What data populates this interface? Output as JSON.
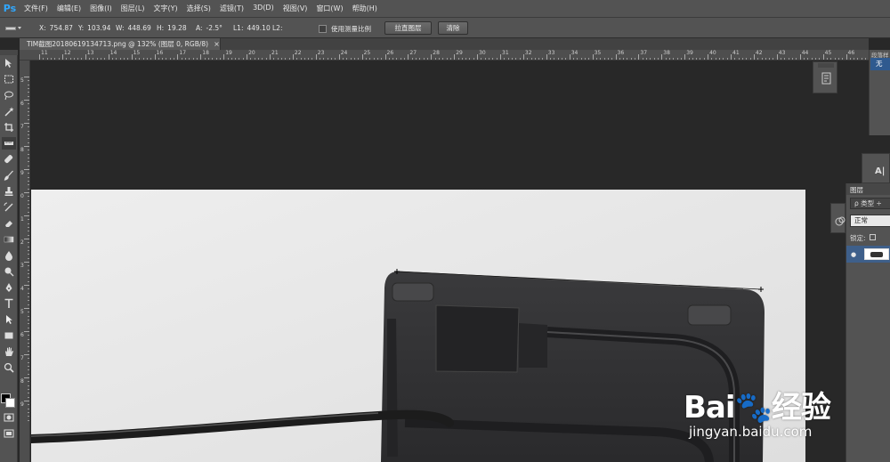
{
  "app": {
    "logo": "Ps",
    "accent": "#31a8ff"
  },
  "menu": [
    "文件(F)",
    "编辑(E)",
    "图像(I)",
    "图层(L)",
    "文字(Y)",
    "选择(S)",
    "滤镜(T)",
    "3D(D)",
    "视图(V)",
    "窗口(W)",
    "帮助(H)"
  ],
  "options": {
    "tool_icon": "ruler-icon",
    "measurements": [
      {
        "label": "X:",
        "value": "754.87"
      },
      {
        "label": "Y:",
        "value": "103.94"
      },
      {
        "label": "W:",
        "value": "448.69"
      },
      {
        "label": "H:",
        "value": "19.28"
      },
      {
        "label": "A:",
        "value": "-2.5°"
      },
      {
        "label": "L1:",
        "value": "449.10"
      },
      {
        "label": "L2:",
        "value": ""
      }
    ],
    "use_scale_label": "使用测量比例",
    "straighten_label": "拉直图层",
    "clear_label": "清除",
    "highlight_color": "#e01e26"
  },
  "document": {
    "tab_title": "TIM截图20180619134713.png @ 132% (图层 0, RGB/8)",
    "close_glyph": "×"
  },
  "ruler_h": {
    "labels": [
      "11",
      "12",
      "13",
      "14",
      "15",
      "16",
      "17",
      "18",
      "19",
      "20",
      "21",
      "22",
      "23",
      "24",
      "25",
      "26",
      "27",
      "28",
      "29",
      "30",
      "31",
      "32",
      "33",
      "34",
      "35",
      "36",
      "37",
      "38",
      "39",
      "40",
      "41",
      "42",
      "43",
      "44",
      "45",
      "46"
    ]
  },
  "ruler_v": {
    "labels": [
      "5",
      "6",
      "7",
      "8",
      "9",
      "0",
      "1",
      "2",
      "3",
      "4",
      "5",
      "6",
      "7",
      "8",
      "9"
    ]
  },
  "panels": {
    "top_panel_tab": "段落样",
    "top_panel_item": "无",
    "char_icon": "A|",
    "layers_tab": "图层",
    "kind_label": "ρ 类型 ÷",
    "blend_mode": "正常",
    "lock_label": "锁定:",
    "selection_color": "#3e5f8a"
  },
  "watermark": {
    "brand": "Bai🐾经验",
    "url": "jingyan.baidu.com"
  }
}
